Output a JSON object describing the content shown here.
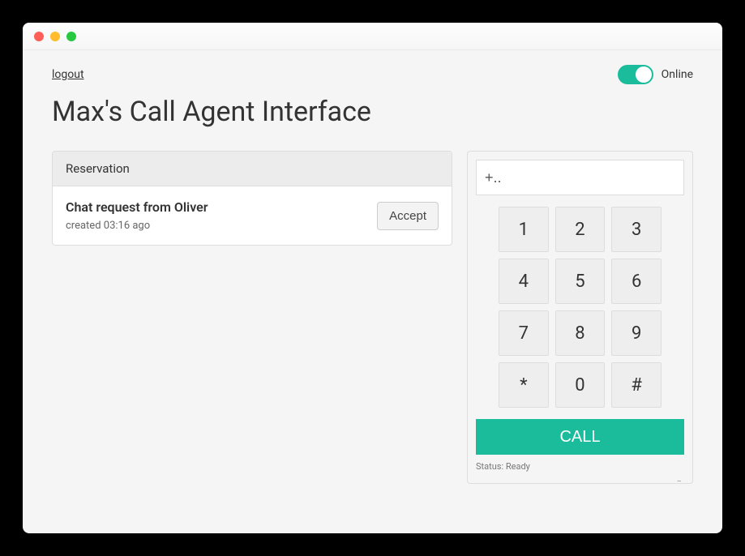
{
  "topbar": {
    "logout": "logout",
    "online_label": "Online"
  },
  "page_title": "Max's Call Agent Interface",
  "reservation": {
    "header": "Reservation",
    "title": "Chat request from Oliver",
    "subtitle": "created 03:16 ago",
    "accept_label": "Accept"
  },
  "dialer": {
    "placeholder": "+..",
    "value": "",
    "keys": [
      "1",
      "2",
      "3",
      "4",
      "5",
      "6",
      "7",
      "8",
      "9",
      "*",
      "0",
      "#"
    ],
    "call_label": "CALL",
    "status": "Status: Ready"
  }
}
